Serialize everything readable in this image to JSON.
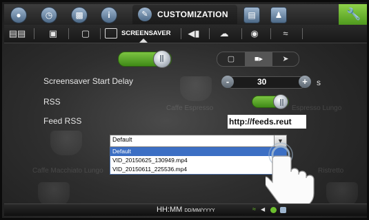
{
  "top_tabs": {
    "active_label": "CUSTOMIZATION"
  },
  "sub_tabs": {
    "active_label": "SCREENSAVER"
  },
  "background_ghost": {
    "texts": [
      "Caffe Espresso",
      "Espresso Lungo",
      "Caffe Macchiato Lungo",
      "Ristretto"
    ]
  },
  "settings": {
    "screensaver_delay": {
      "label": "Screensaver Start Delay",
      "value": "30",
      "unit": "s",
      "minus": "-",
      "plus": "+"
    },
    "rss": {
      "label": "RSS",
      "enabled": true
    },
    "feed_rss": {
      "label": "Feed RSS",
      "url": "http://feeds.reut"
    },
    "screensaver_enabled": true,
    "media_type_selected": "video"
  },
  "dropdown": {
    "value": "Default",
    "options": [
      "Default",
      "VID_20150625_130949.mp4",
      "VID_20150611_225536.mp4"
    ],
    "selected_index": 0
  },
  "status_bar": {
    "time": "HH:MM",
    "date": "DD/MM/YYYY"
  },
  "colors": {
    "accent_green": "#6cbf2e",
    "tab_blue": "#6f8bab",
    "selection_blue": "#3c6fc4"
  }
}
